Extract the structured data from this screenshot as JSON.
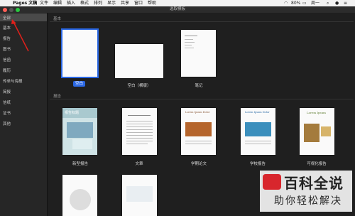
{
  "menubar": {
    "app_name": "Pages 文稿",
    "items": [
      "文件",
      "编辑",
      "插入",
      "格式",
      "排列",
      "显示",
      "共享",
      "窗口",
      "帮助"
    ],
    "status": "80%",
    "time": "周一"
  },
  "window": {
    "title": "选取模板"
  },
  "sidebar": {
    "items": [
      "全部",
      "基本",
      "报告",
      "图书",
      "信函",
      "履历",
      "传单与海报",
      "简报",
      "信纸",
      "证书",
      "其他"
    ]
  },
  "sections": {
    "basic": "基本",
    "reports": "报告"
  },
  "basic_templates": [
    {
      "label": "空白"
    },
    {
      "label": "空白（横版）"
    },
    {
      "label": "笔记"
    }
  ],
  "report_templates": [
    {
      "label": "新型报告"
    },
    {
      "label": "文章"
    },
    {
      "label": "学期论文"
    },
    {
      "label": "学校报告"
    },
    {
      "label": "可视化报告"
    }
  ],
  "thumb_text": {
    "report_title": "报告标题",
    "term_paper": "Lorem Ipsum Dolor",
    "school_report": "Lorem Ipsum Dolor",
    "visual_report": "Lorem Ipsum"
  },
  "watermark": {
    "line1": "百科全说",
    "line2": "助你轻松解决"
  },
  "colors": {
    "accent": "#2a67e3",
    "arrow": "#e0201b"
  }
}
